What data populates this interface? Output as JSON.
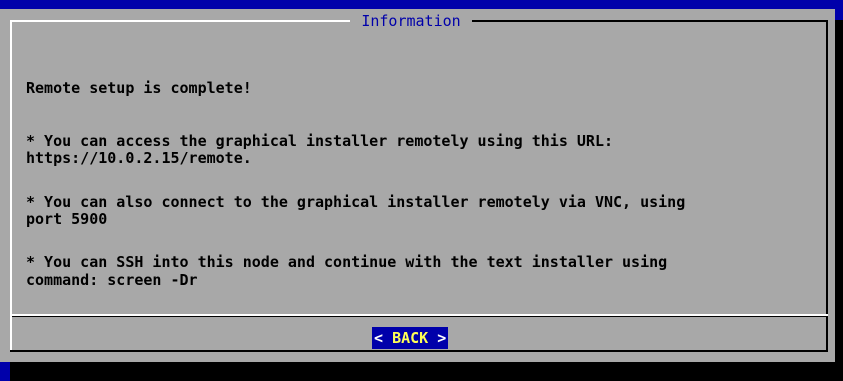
{
  "dialog": {
    "title": "Information",
    "lines": {
      "heading": "Remote setup is complete!",
      "bullet1_line1": "* You can access the graphical installer remotely using this URL:",
      "bullet1_line2": "https://10.0.2.15/remote.",
      "bullet2_line1": "* You can also connect to the graphical installer remotely via VNC, using",
      "bullet2_line2": "port 5900",
      "bullet3_line1": "* You can SSH into this node and continue with the text installer using",
      "bullet3_line2": "command: screen -Dr"
    },
    "button": {
      "open_bracket": "<",
      "label": "BACK",
      "close_bracket": ">"
    }
  },
  "colors": {
    "background": "#0000aa",
    "dialog": "#a8a8a8",
    "title": "#0000aa",
    "button_bg": "#0000aa",
    "button_text": "#ffff55"
  }
}
